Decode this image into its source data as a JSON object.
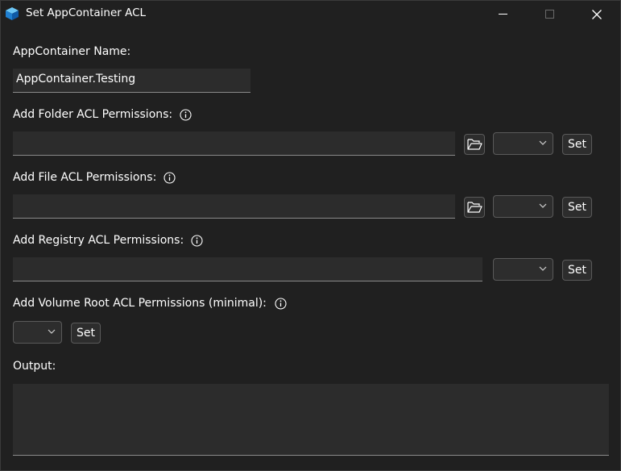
{
  "window": {
    "title": "Set AppContainer ACL",
    "icon": "appcontainer-cube-icon",
    "caption_buttons": [
      "minimize-icon",
      "maximize-icon",
      "close-icon"
    ]
  },
  "appcontainer_name": {
    "label": "AppContainer Name:",
    "value": "AppContainer.Testing"
  },
  "folder_acl": {
    "label": "Add Folder ACL Permissions:",
    "path_value": "",
    "browse_icon": "folder-open-icon",
    "permission_selected": "",
    "set_label": "Set"
  },
  "file_acl": {
    "label": "Add File ACL Permissions:",
    "path_value": "",
    "browse_icon": "folder-open-icon",
    "permission_selected": "",
    "set_label": "Set"
  },
  "registry_acl": {
    "label": "Add Registry ACL Permissions:",
    "path_value": "",
    "permission_selected": "",
    "set_label": "Set"
  },
  "volume_acl": {
    "label": "Add Volume Root ACL Permissions (minimal):",
    "permission_selected": "",
    "set_label": "Set"
  },
  "output": {
    "label": "Output:",
    "value": ""
  },
  "colors": {
    "background": "#202020",
    "control_fill": "#2c2c2c",
    "text": "#ffffff",
    "accent": "#2b8fd9"
  }
}
